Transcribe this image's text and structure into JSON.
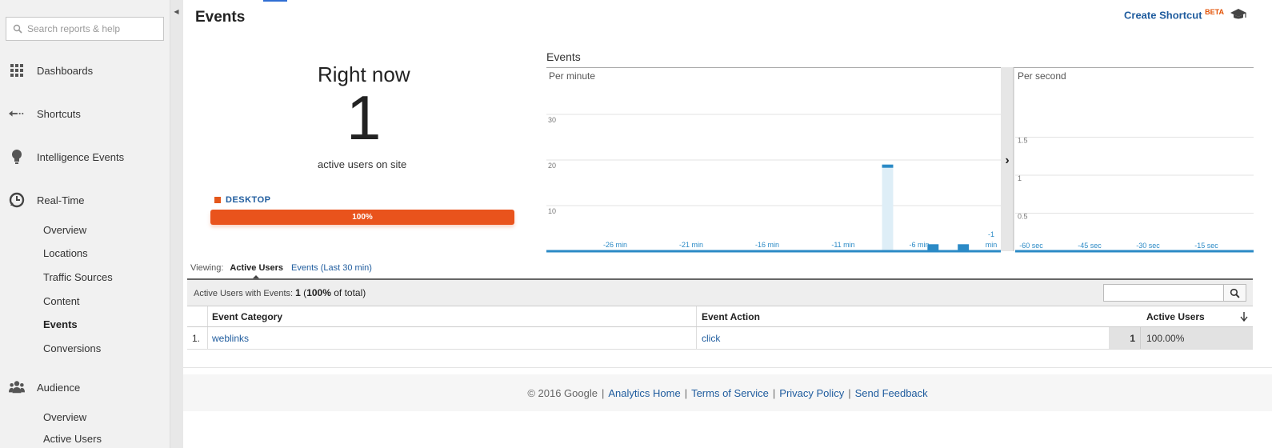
{
  "sidebar": {
    "search_placeholder": "Search reports & help",
    "items": [
      {
        "label": "Dashboards",
        "icon": "grid-icon"
      },
      {
        "label": "Shortcuts",
        "icon": "arrow-left-icon"
      },
      {
        "label": "Intelligence Events",
        "icon": "lightbulb-icon"
      },
      {
        "label": "Real-Time",
        "icon": "clock-icon"
      },
      {
        "label": "Audience",
        "icon": "people-icon"
      }
    ],
    "realtime_sub": [
      "Overview",
      "Locations",
      "Traffic Sources",
      "Content",
      "Events",
      "Conversions"
    ],
    "realtime_active": "Events",
    "audience_sub": [
      "Overview",
      "Active Users"
    ]
  },
  "header": {
    "title": "Events",
    "create_shortcut": "Create Shortcut",
    "beta": "BETA"
  },
  "right_now": {
    "title": "Right now",
    "count": "1",
    "subtitle": "active users on site",
    "device_label": "DESKTOP",
    "device_pct": "100%",
    "device_pct_value": 100
  },
  "chart_data": {
    "type": "bar",
    "title": "Events",
    "panels": [
      {
        "name": "Per minute",
        "y_ticks": [
          "30",
          "20",
          "10"
        ],
        "ylim": [
          0,
          30
        ],
        "x_tick_labels": [
          "-26 min",
          "-21 min",
          "-16 min",
          "-11 min",
          "-6 min",
          "-1 min"
        ],
        "x_ticks_last_split": [
          "-1",
          "min"
        ],
        "x": [
          "-30 min",
          "-29 min",
          "-28 min",
          "-27 min",
          "-26 min",
          "-25 min",
          "-24 min",
          "-23 min",
          "-22 min",
          "-21 min",
          "-20 min",
          "-19 min",
          "-18 min",
          "-17 min",
          "-16 min",
          "-15 min",
          "-14 min",
          "-13 min",
          "-12 min",
          "-11 min",
          "-10 min",
          "-9 min",
          "-8 min",
          "-7 min",
          "-6 min",
          "-5 min",
          "-4 min",
          "-3 min",
          "-2 min",
          "-1 min"
        ],
        "values": [
          0,
          0,
          0,
          0,
          0,
          0,
          0,
          0,
          0,
          0,
          0,
          0,
          0,
          0,
          0,
          0,
          0,
          0,
          0,
          0,
          0,
          0,
          19,
          0,
          0,
          1,
          0,
          1,
          0,
          0
        ]
      },
      {
        "name": "Per second",
        "y_ticks": [
          "1.5",
          "1",
          "0.5"
        ],
        "ylim": [
          0,
          2
        ],
        "x_tick_labels": [
          "-60 sec",
          "-45 sec",
          "-30 sec",
          "-15 sec"
        ],
        "values": [
          0
        ]
      }
    ],
    "colors": {
      "bar": "#2b8ac6",
      "highlight": "#deeef7"
    }
  },
  "viewing": {
    "label": "Viewing:",
    "active_tab": "Active Users",
    "other_tab": "Events (Last 30 min)"
  },
  "table": {
    "summary_prefix": "Active Users with Events:",
    "summary_count": "1",
    "summary_pct": "100%",
    "summary_suffix": "of total)",
    "columns": [
      "Event Category",
      "Event Action",
      "Active Users"
    ],
    "rows": [
      {
        "idx": "1.",
        "category": "weblinks",
        "action": "click",
        "users": "1",
        "pct": "100.00%"
      }
    ]
  },
  "footer": {
    "copyright": "© 2016 Google",
    "links": [
      "Analytics Home",
      "Terms of Service",
      "Privacy Policy",
      "Send Feedback"
    ]
  },
  "colors": {
    "accent": "#1f5c9e",
    "device_bar": "#e9531c",
    "beta": "#e35205"
  }
}
